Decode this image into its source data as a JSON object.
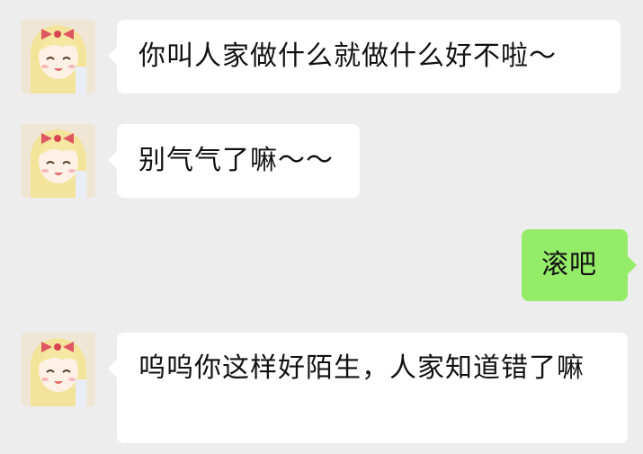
{
  "messages": [
    {
      "sender": "other",
      "avatar_icon": "anime-girl-avatar-icon",
      "text": "你叫人家做什么就做什么好不啦～"
    },
    {
      "sender": "other",
      "avatar_icon": "anime-girl-avatar-icon",
      "text": "别气气了嘛～～"
    },
    {
      "sender": "me",
      "text": "滚吧"
    },
    {
      "sender": "other",
      "avatar_icon": "anime-girl-avatar-icon",
      "text": "呜呜你这样好陌生，人家知道错了嘛"
    }
  ],
  "colors": {
    "background": "#ededed",
    "incoming_bubble": "#ffffff",
    "outgoing_bubble": "#95ec69",
    "text": "#111111"
  }
}
